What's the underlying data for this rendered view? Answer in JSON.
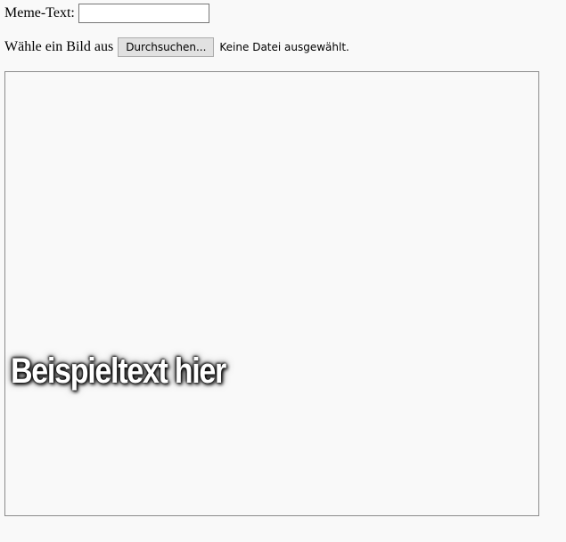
{
  "form": {
    "meme_text_label": "Meme-Text:",
    "meme_text_value": "",
    "image_label": "Wähle ein Bild aus",
    "browse_button_label": "Durchsuchen...",
    "file_status": "Keine Datei ausgewählt."
  },
  "canvas": {
    "overlay_text": "Beispieltext hier"
  }
}
